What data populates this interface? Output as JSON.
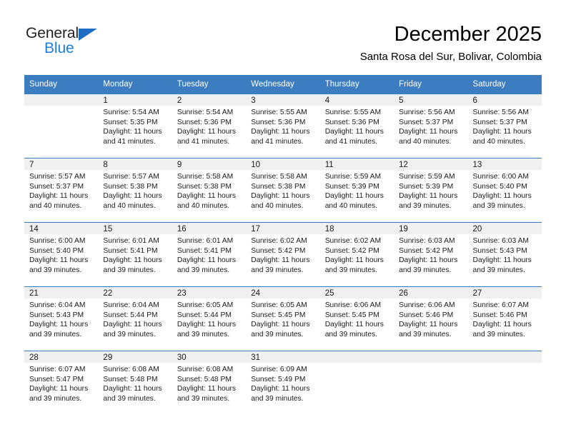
{
  "brand": {
    "name_part1": "General",
    "name_part2": "Blue",
    "triangle_icon": "triangle-icon",
    "color_dark": "#231f20",
    "color_blue": "#1b7fd4"
  },
  "header": {
    "title": "December 2025",
    "subtitle": "Santa Rosa del Sur, Bolivar, Colombia"
  },
  "theme": {
    "header_bg": "#3b7dc0",
    "daynum_bg": "#f0f0f0",
    "text": "#1a1a1a"
  },
  "weekdays": [
    "Sunday",
    "Monday",
    "Tuesday",
    "Wednesday",
    "Thursday",
    "Friday",
    "Saturday"
  ],
  "weeks": [
    [
      {
        "day": ""
      },
      {
        "day": "1",
        "sunrise": "Sunrise: 5:54 AM",
        "sunset": "Sunset: 5:35 PM",
        "daylight_l1": "Daylight: 11 hours",
        "daylight_l2": "and 41 minutes."
      },
      {
        "day": "2",
        "sunrise": "Sunrise: 5:54 AM",
        "sunset": "Sunset: 5:36 PM",
        "daylight_l1": "Daylight: 11 hours",
        "daylight_l2": "and 41 minutes."
      },
      {
        "day": "3",
        "sunrise": "Sunrise: 5:55 AM",
        "sunset": "Sunset: 5:36 PM",
        "daylight_l1": "Daylight: 11 hours",
        "daylight_l2": "and 41 minutes."
      },
      {
        "day": "4",
        "sunrise": "Sunrise: 5:55 AM",
        "sunset": "Sunset: 5:36 PM",
        "daylight_l1": "Daylight: 11 hours",
        "daylight_l2": "and 41 minutes."
      },
      {
        "day": "5",
        "sunrise": "Sunrise: 5:56 AM",
        "sunset": "Sunset: 5:37 PM",
        "daylight_l1": "Daylight: 11 hours",
        "daylight_l2": "and 40 minutes."
      },
      {
        "day": "6",
        "sunrise": "Sunrise: 5:56 AM",
        "sunset": "Sunset: 5:37 PM",
        "daylight_l1": "Daylight: 11 hours",
        "daylight_l2": "and 40 minutes."
      }
    ],
    [
      {
        "day": "7",
        "sunrise": "Sunrise: 5:57 AM",
        "sunset": "Sunset: 5:37 PM",
        "daylight_l1": "Daylight: 11 hours",
        "daylight_l2": "and 40 minutes."
      },
      {
        "day": "8",
        "sunrise": "Sunrise: 5:57 AM",
        "sunset": "Sunset: 5:38 PM",
        "daylight_l1": "Daylight: 11 hours",
        "daylight_l2": "and 40 minutes."
      },
      {
        "day": "9",
        "sunrise": "Sunrise: 5:58 AM",
        "sunset": "Sunset: 5:38 PM",
        "daylight_l1": "Daylight: 11 hours",
        "daylight_l2": "and 40 minutes."
      },
      {
        "day": "10",
        "sunrise": "Sunrise: 5:58 AM",
        "sunset": "Sunset: 5:38 PM",
        "daylight_l1": "Daylight: 11 hours",
        "daylight_l2": "and 40 minutes."
      },
      {
        "day": "11",
        "sunrise": "Sunrise: 5:59 AM",
        "sunset": "Sunset: 5:39 PM",
        "daylight_l1": "Daylight: 11 hours",
        "daylight_l2": "and 40 minutes."
      },
      {
        "day": "12",
        "sunrise": "Sunrise: 5:59 AM",
        "sunset": "Sunset: 5:39 PM",
        "daylight_l1": "Daylight: 11 hours",
        "daylight_l2": "and 39 minutes."
      },
      {
        "day": "13",
        "sunrise": "Sunrise: 6:00 AM",
        "sunset": "Sunset: 5:40 PM",
        "daylight_l1": "Daylight: 11 hours",
        "daylight_l2": "and 39 minutes."
      }
    ],
    [
      {
        "day": "14",
        "sunrise": "Sunrise: 6:00 AM",
        "sunset": "Sunset: 5:40 PM",
        "daylight_l1": "Daylight: 11 hours",
        "daylight_l2": "and 39 minutes."
      },
      {
        "day": "15",
        "sunrise": "Sunrise: 6:01 AM",
        "sunset": "Sunset: 5:41 PM",
        "daylight_l1": "Daylight: 11 hours",
        "daylight_l2": "and 39 minutes."
      },
      {
        "day": "16",
        "sunrise": "Sunrise: 6:01 AM",
        "sunset": "Sunset: 5:41 PM",
        "daylight_l1": "Daylight: 11 hours",
        "daylight_l2": "and 39 minutes."
      },
      {
        "day": "17",
        "sunrise": "Sunrise: 6:02 AM",
        "sunset": "Sunset: 5:42 PM",
        "daylight_l1": "Daylight: 11 hours",
        "daylight_l2": "and 39 minutes."
      },
      {
        "day": "18",
        "sunrise": "Sunrise: 6:02 AM",
        "sunset": "Sunset: 5:42 PM",
        "daylight_l1": "Daylight: 11 hours",
        "daylight_l2": "and 39 minutes."
      },
      {
        "day": "19",
        "sunrise": "Sunrise: 6:03 AM",
        "sunset": "Sunset: 5:42 PM",
        "daylight_l1": "Daylight: 11 hours",
        "daylight_l2": "and 39 minutes."
      },
      {
        "day": "20",
        "sunrise": "Sunrise: 6:03 AM",
        "sunset": "Sunset: 5:43 PM",
        "daylight_l1": "Daylight: 11 hours",
        "daylight_l2": "and 39 minutes."
      }
    ],
    [
      {
        "day": "21",
        "sunrise": "Sunrise: 6:04 AM",
        "sunset": "Sunset: 5:43 PM",
        "daylight_l1": "Daylight: 11 hours",
        "daylight_l2": "and 39 minutes."
      },
      {
        "day": "22",
        "sunrise": "Sunrise: 6:04 AM",
        "sunset": "Sunset: 5:44 PM",
        "daylight_l1": "Daylight: 11 hours",
        "daylight_l2": "and 39 minutes."
      },
      {
        "day": "23",
        "sunrise": "Sunrise: 6:05 AM",
        "sunset": "Sunset: 5:44 PM",
        "daylight_l1": "Daylight: 11 hours",
        "daylight_l2": "and 39 minutes."
      },
      {
        "day": "24",
        "sunrise": "Sunrise: 6:05 AM",
        "sunset": "Sunset: 5:45 PM",
        "daylight_l1": "Daylight: 11 hours",
        "daylight_l2": "and 39 minutes."
      },
      {
        "day": "25",
        "sunrise": "Sunrise: 6:06 AM",
        "sunset": "Sunset: 5:45 PM",
        "daylight_l1": "Daylight: 11 hours",
        "daylight_l2": "and 39 minutes."
      },
      {
        "day": "26",
        "sunrise": "Sunrise: 6:06 AM",
        "sunset": "Sunset: 5:46 PM",
        "daylight_l1": "Daylight: 11 hours",
        "daylight_l2": "and 39 minutes."
      },
      {
        "day": "27",
        "sunrise": "Sunrise: 6:07 AM",
        "sunset": "Sunset: 5:46 PM",
        "daylight_l1": "Daylight: 11 hours",
        "daylight_l2": "and 39 minutes."
      }
    ],
    [
      {
        "day": "28",
        "sunrise": "Sunrise: 6:07 AM",
        "sunset": "Sunset: 5:47 PM",
        "daylight_l1": "Daylight: 11 hours",
        "daylight_l2": "and 39 minutes."
      },
      {
        "day": "29",
        "sunrise": "Sunrise: 6:08 AM",
        "sunset": "Sunset: 5:48 PM",
        "daylight_l1": "Daylight: 11 hours",
        "daylight_l2": "and 39 minutes."
      },
      {
        "day": "30",
        "sunrise": "Sunrise: 6:08 AM",
        "sunset": "Sunset: 5:48 PM",
        "daylight_l1": "Daylight: 11 hours",
        "daylight_l2": "and 39 minutes."
      },
      {
        "day": "31",
        "sunrise": "Sunrise: 6:09 AM",
        "sunset": "Sunset: 5:49 PM",
        "daylight_l1": "Daylight: 11 hours",
        "daylight_l2": "and 39 minutes."
      },
      {
        "day": ""
      },
      {
        "day": ""
      },
      {
        "day": ""
      }
    ]
  ]
}
